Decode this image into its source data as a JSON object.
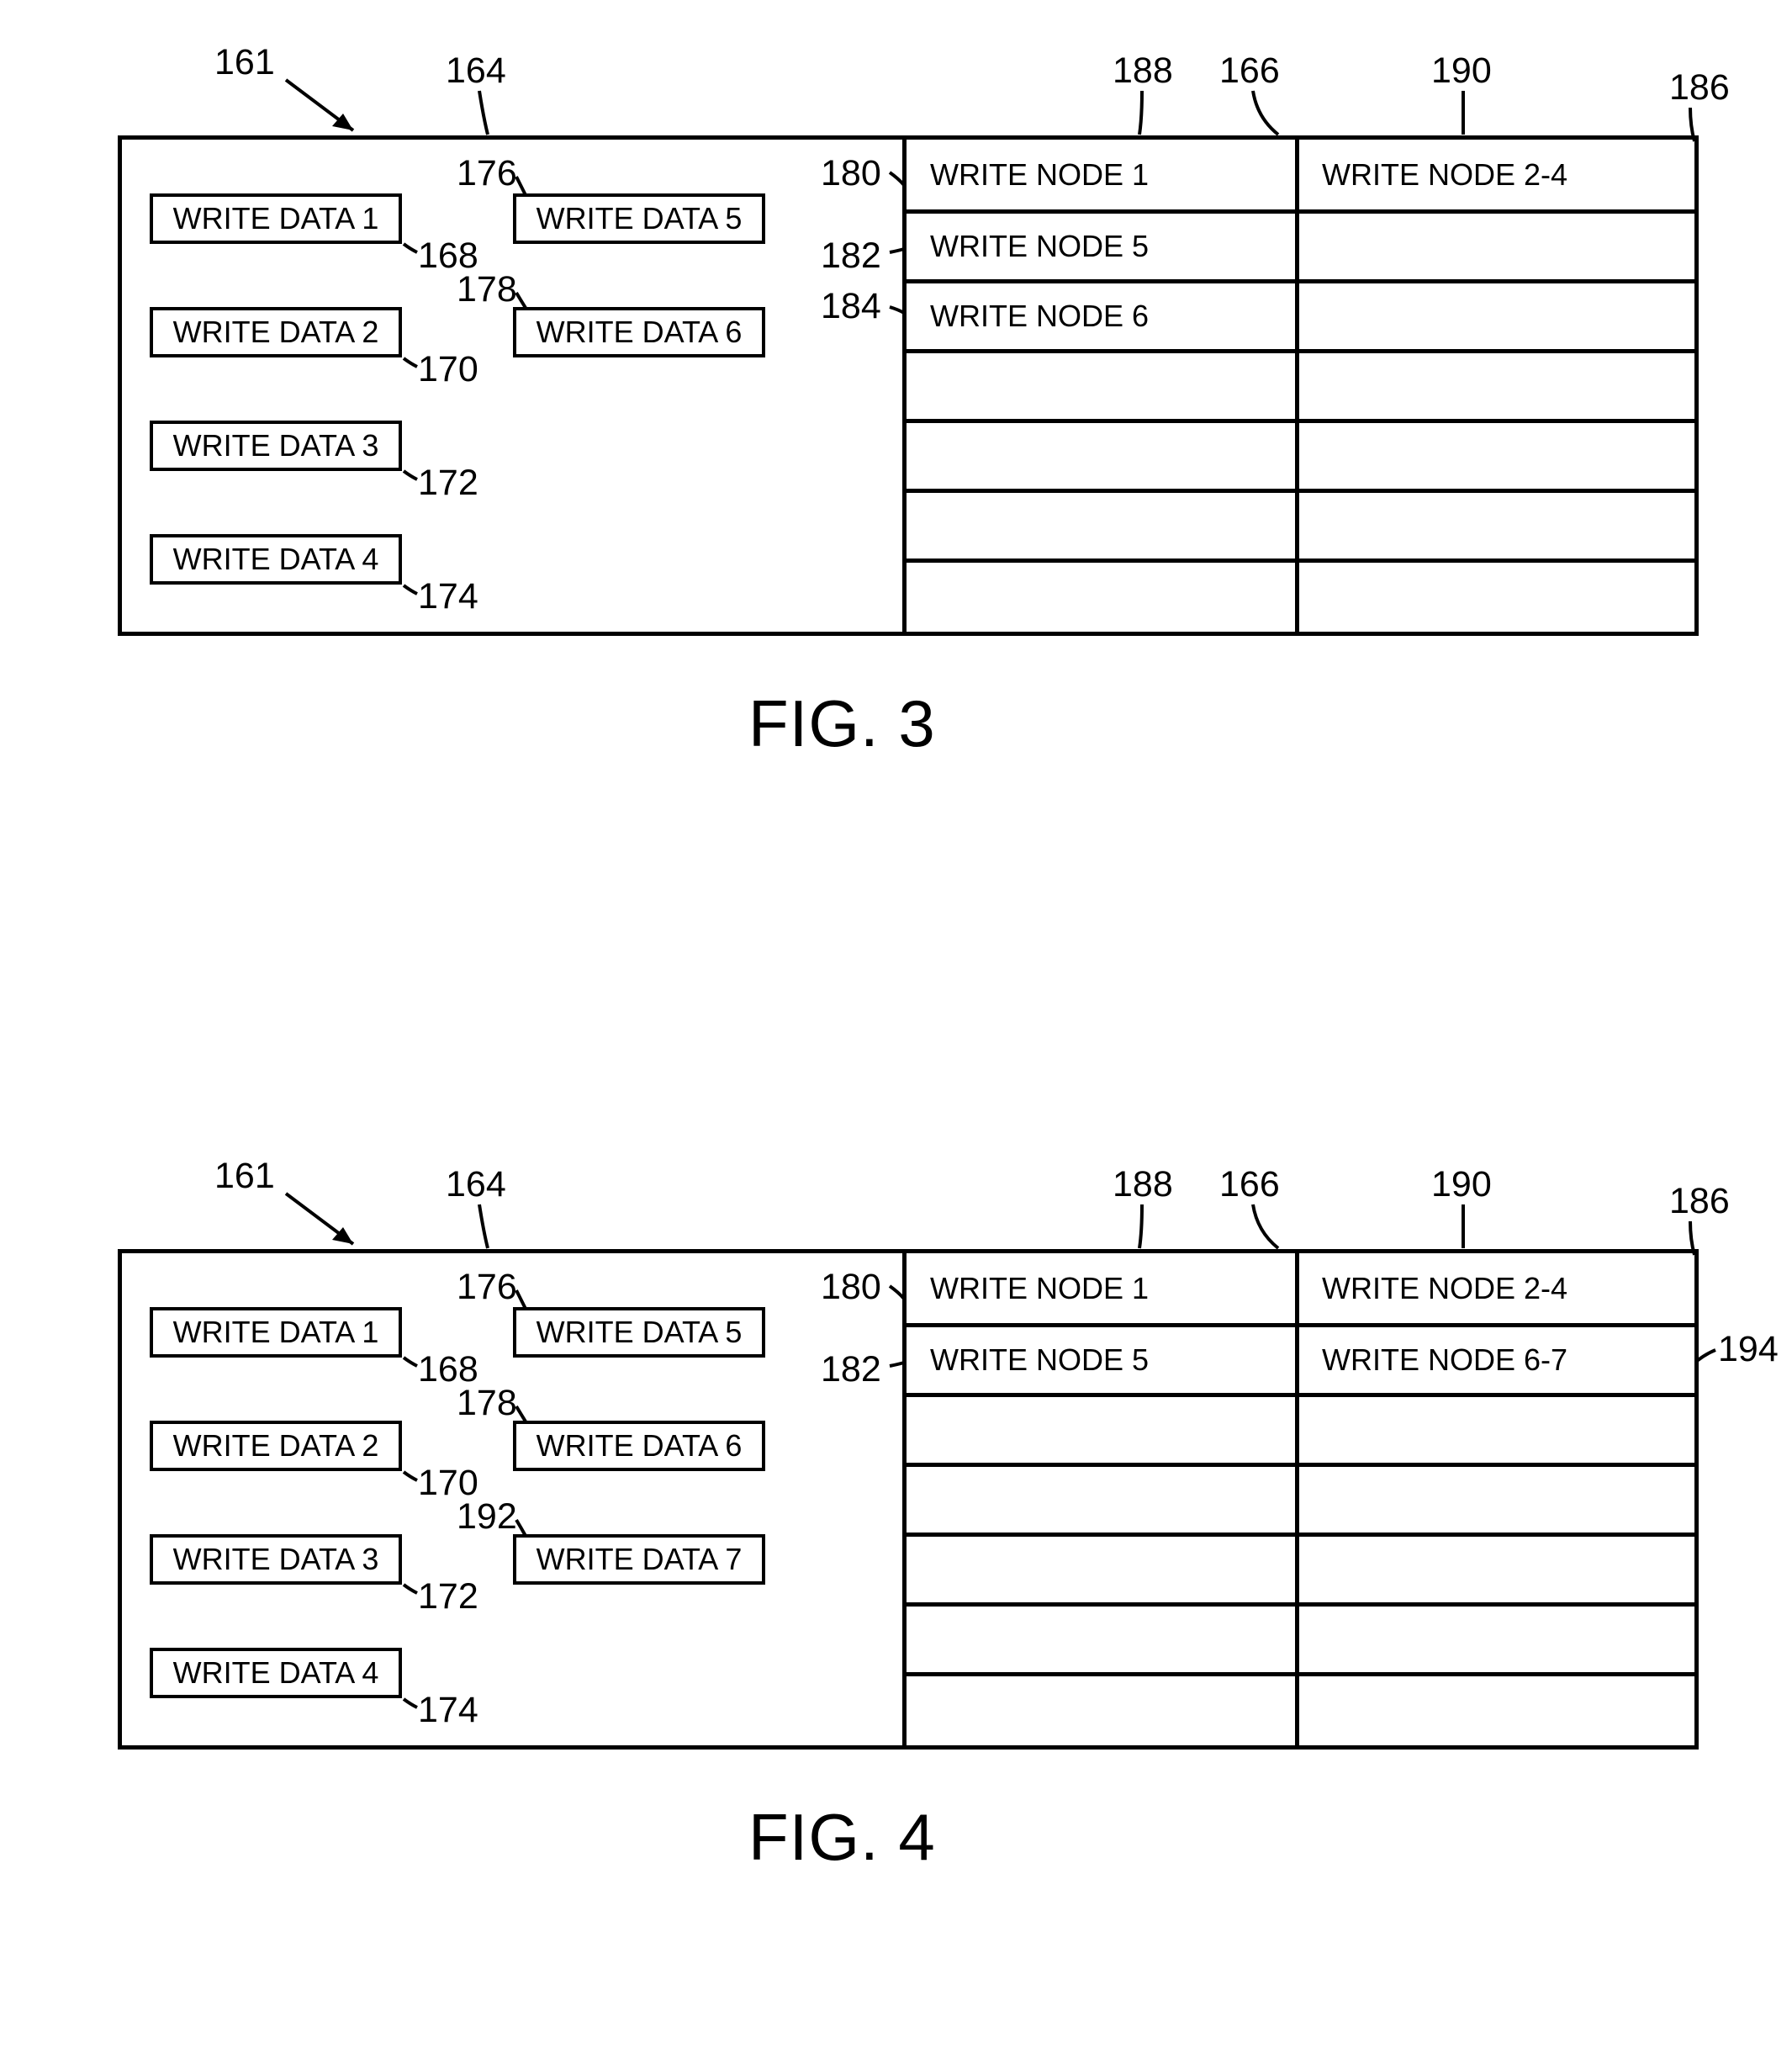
{
  "figures": {
    "fig3": {
      "title": "FIG. 3",
      "refs": {
        "r161": "161",
        "r164": "164",
        "r188": "188",
        "r166": "166",
        "r190": "190",
        "r186": "186",
        "r176": "176",
        "r180": "180",
        "r168": "168",
        "r182": "182",
        "r178": "178",
        "r184": "184",
        "r170": "170",
        "r172": "172",
        "r174": "174"
      },
      "data_boxes": {
        "d1": "WRITE DATA 1",
        "d2": "WRITE DATA 2",
        "d3": "WRITE DATA 3",
        "d4": "WRITE DATA 4",
        "d5": "WRITE DATA 5",
        "d6": "WRITE DATA 6"
      },
      "table_rows": [
        {
          "col1": "WRITE NODE 1",
          "col2": "WRITE NODE 2-4"
        },
        {
          "col1": "WRITE NODE 5",
          "col2": ""
        },
        {
          "col1": "WRITE NODE 6",
          "col2": ""
        },
        {
          "col1": "",
          "col2": ""
        },
        {
          "col1": "",
          "col2": ""
        },
        {
          "col1": "",
          "col2": ""
        },
        {
          "col1": "",
          "col2": ""
        }
      ]
    },
    "fig4": {
      "title": "FIG. 4",
      "refs": {
        "r161": "161",
        "r164": "164",
        "r188": "188",
        "r166": "166",
        "r190": "190",
        "r186": "186",
        "r194": "194",
        "r176": "176",
        "r180": "180",
        "r168": "168",
        "r182": "182",
        "r178": "178",
        "r170": "170",
        "r192": "192",
        "r172": "172",
        "r174": "174"
      },
      "data_boxes": {
        "d1": "WRITE DATA 1",
        "d2": "WRITE DATA 2",
        "d3": "WRITE DATA 3",
        "d4": "WRITE DATA 4",
        "d5": "WRITE DATA 5",
        "d6": "WRITE DATA 6",
        "d7": "WRITE DATA 7"
      },
      "table_rows": [
        {
          "col1": "WRITE NODE 1",
          "col2": "WRITE NODE 2-4"
        },
        {
          "col1": "WRITE NODE 5",
          "col2": "WRITE NODE 6-7"
        },
        {
          "col1": "",
          "col2": ""
        },
        {
          "col1": "",
          "col2": ""
        },
        {
          "col1": "",
          "col2": ""
        },
        {
          "col1": "",
          "col2": ""
        },
        {
          "col1": "",
          "col2": ""
        }
      ]
    }
  }
}
